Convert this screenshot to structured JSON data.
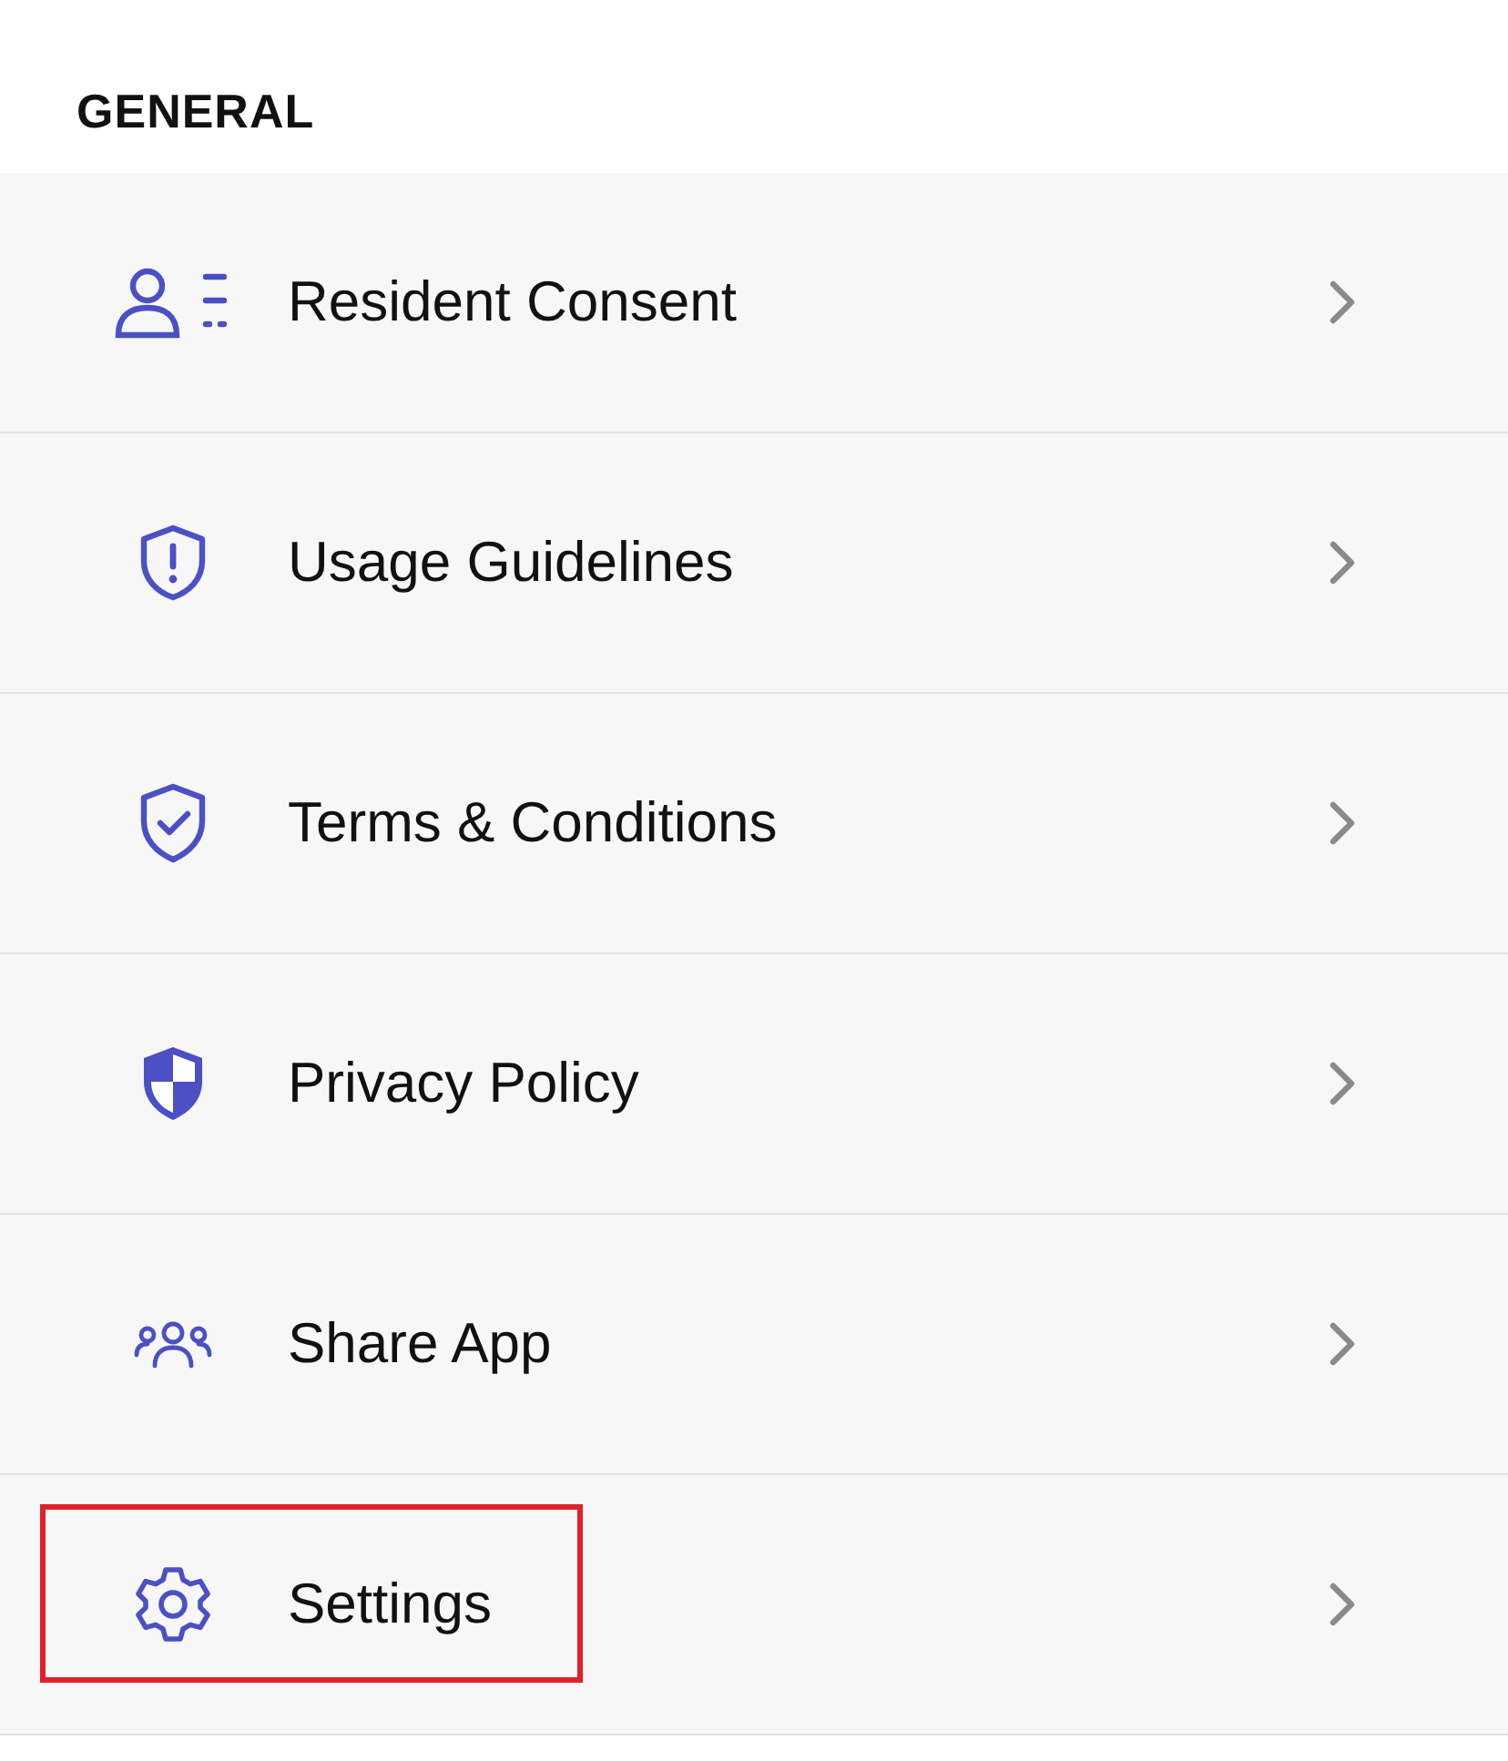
{
  "section": {
    "title": "GENERAL"
  },
  "items": [
    {
      "label": "Resident Consent",
      "highlighted": false
    },
    {
      "label": "Usage Guidelines",
      "highlighted": false
    },
    {
      "label": "Terms & Conditions",
      "highlighted": false
    },
    {
      "label": "Privacy Policy",
      "highlighted": false
    },
    {
      "label": "Share App",
      "highlighted": false
    },
    {
      "label": "Settings",
      "highlighted": true
    }
  ]
}
